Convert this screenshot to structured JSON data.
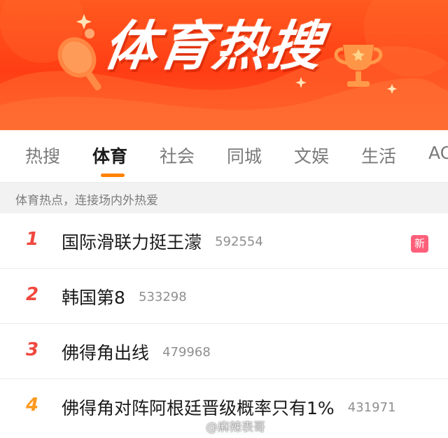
{
  "banner": {
    "title": "体育热搜",
    "colors": {
      "background": "#ff4a1a",
      "text": "#ffffff"
    },
    "icons": [
      "ping-pong-paddle-icon",
      "trophy-icon"
    ]
  },
  "tabs": [
    {
      "label": "热搜",
      "active": false
    },
    {
      "label": "体育",
      "active": true
    },
    {
      "label": "社会",
      "active": false
    },
    {
      "label": "同城",
      "active": false
    },
    {
      "label": "文娱",
      "active": false
    },
    {
      "label": "生活",
      "active": false
    },
    {
      "label": "AC",
      "active": false
    }
  ],
  "accent_color": "#ff8200",
  "subheader": {
    "text": "体育热点，连接场内外热爱"
  },
  "list": [
    {
      "rank": "1",
      "title": "国际滑联力挺王濛",
      "count": "592554",
      "badge": "新",
      "rank_color": "#f0483e"
    },
    {
      "rank": "2",
      "title": "韩国第8",
      "count": "533298",
      "badge": "",
      "rank_color": "#f0483e"
    },
    {
      "rank": "3",
      "title": "佛得角出线",
      "count": "479968",
      "badge": "",
      "rank_color": "#f0483e"
    },
    {
      "rank": "4",
      "title": "佛得角对阵阿根廷晋级概率只有1%",
      "count": "431971",
      "badge": "",
      "rank_color": "#ff9a1f"
    }
  ],
  "badge_color": "#ff5f7a",
  "watermark": {
    "text": "@麻辣表哥"
  }
}
